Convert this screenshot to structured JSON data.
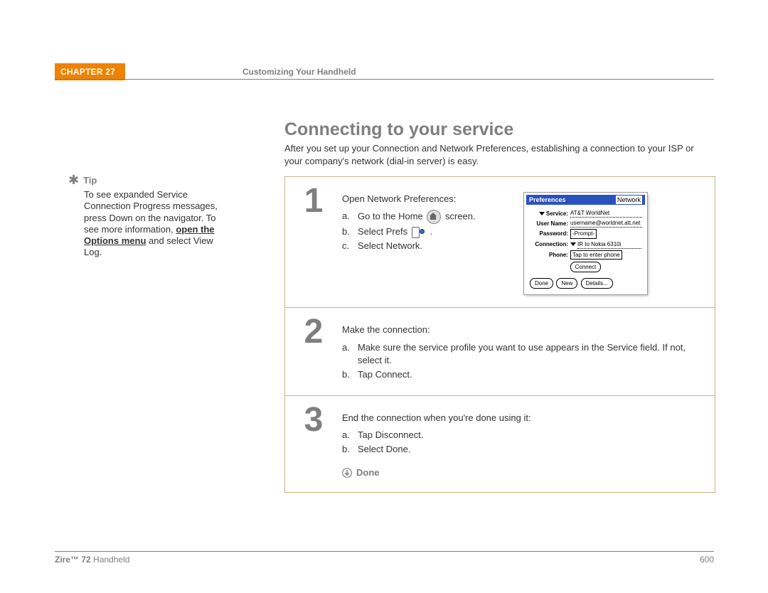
{
  "header": {
    "chapter": "CHAPTER 27",
    "title": "Customizing Your Handheld"
  },
  "heading": "Connecting to your service",
  "intro": "After you set up your Connection and Network Preferences, establishing a connection to your ISP or your company's network (dial-in server) is easy.",
  "tip": {
    "label": "Tip",
    "before": "To see expanded Service Connection Progress messages, press Down on the navigator. To see more information, ",
    "link": "open the Options menu",
    "after": " and select View Log."
  },
  "steps": [
    {
      "num": "1",
      "lead": "Open Network Preferences:",
      "subs": [
        {
          "l": "a.",
          "pre": "Go to the Home ",
          "icon": "home",
          "post": " screen."
        },
        {
          "l": "b.",
          "pre": "Select Prefs ",
          "icon": "prefs",
          "post": " ."
        },
        {
          "l": "c.",
          "pre": "Select Network.",
          "icon": "",
          "post": ""
        }
      ]
    },
    {
      "num": "2",
      "lead": "Make the connection:",
      "subs": [
        {
          "l": "a.",
          "pre": "Make sure the service profile you want to use appears in the Service field. If not, select it.",
          "icon": "",
          "post": ""
        },
        {
          "l": "b.",
          "pre": "Tap Connect.",
          "icon": "",
          "post": ""
        }
      ]
    },
    {
      "num": "3",
      "lead": "End the connection when you're done using it:",
      "subs": [
        {
          "l": "a.",
          "pre": "Tap Disconnect.",
          "icon": "",
          "post": ""
        },
        {
          "l": "b.",
          "pre": "Select Done.",
          "icon": "",
          "post": ""
        }
      ],
      "done": "Done"
    }
  ],
  "screenshot": {
    "title": "Preferences",
    "category": "Network",
    "service_label": "Service:",
    "service_value": "AT&T WorldNet",
    "username_label": "User Name:",
    "username_value": "username@worldnet.att.net",
    "password_label": "Password:",
    "password_value": "-Prompt-",
    "connection_label": "Connection:",
    "connection_value": "IR to Nokia 6310i",
    "phone_label": "Phone:",
    "phone_value": "Tap to enter phone",
    "connect_btn": "Connect",
    "done_btn": "Done",
    "new_btn": "New",
    "details_btn": "Details..."
  },
  "footer": {
    "product_bold": "Zire™ 72",
    "product_rest": " Handheld",
    "page": "600"
  }
}
